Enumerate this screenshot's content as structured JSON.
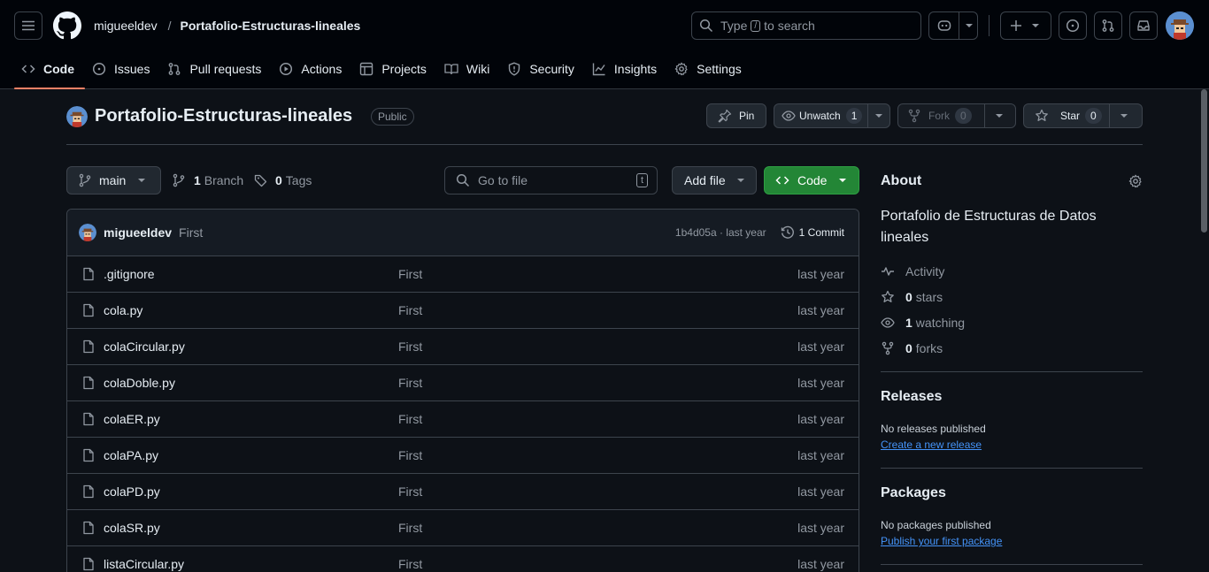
{
  "header": {
    "owner": "migueeldev",
    "separator": "/",
    "repo": "Portafolio-Estructuras-lineales",
    "search_prefix": "Type",
    "search_key": "/",
    "search_suffix": "to search"
  },
  "tabs": [
    {
      "label": "Code",
      "icon": "code-icon"
    },
    {
      "label": "Issues",
      "icon": "issue-icon"
    },
    {
      "label": "Pull requests",
      "icon": "pull-request-icon"
    },
    {
      "label": "Actions",
      "icon": "play-icon"
    },
    {
      "label": "Projects",
      "icon": "table-icon"
    },
    {
      "label": "Wiki",
      "icon": "book-icon"
    },
    {
      "label": "Security",
      "icon": "shield-icon"
    },
    {
      "label": "Insights",
      "icon": "graph-icon"
    },
    {
      "label": "Settings",
      "icon": "gear-icon"
    }
  ],
  "repo": {
    "title": "Portafolio-Estructuras-lineales",
    "visibility": "Public",
    "pin": "Pin",
    "unwatch": "Unwatch",
    "watch_count": "1",
    "fork": "Fork",
    "fork_count": "0",
    "star": "Star",
    "star_count": "0"
  },
  "toolbar": {
    "branch": "main",
    "branch_count": "1",
    "branch_label": "Branch",
    "tag_count": "0",
    "tag_label": "Tags",
    "goto_placeholder": "Go to file",
    "goto_key": "t",
    "add_file": "Add file",
    "code": "Code"
  },
  "commit": {
    "author": "migueeldev",
    "message": "First",
    "hash_time": "1b4d05a · last year",
    "commits": "1 Commit"
  },
  "files": [
    {
      "name": ".gitignore",
      "message": "First",
      "date": "last year"
    },
    {
      "name": "cola.py",
      "message": "First",
      "date": "last year"
    },
    {
      "name": "colaCircular.py",
      "message": "First",
      "date": "last year"
    },
    {
      "name": "colaDoble.py",
      "message": "First",
      "date": "last year"
    },
    {
      "name": "colaER.py",
      "message": "First",
      "date": "last year"
    },
    {
      "name": "colaPA.py",
      "message": "First",
      "date": "last year"
    },
    {
      "name": "colaPD.py",
      "message": "First",
      "date": "last year"
    },
    {
      "name": "colaSR.py",
      "message": "First",
      "date": "last year"
    },
    {
      "name": "listaCircular.py",
      "message": "First",
      "date": "last year"
    }
  ],
  "about": {
    "title": "About",
    "description": "Portafolio de Estructuras de Datos lineales",
    "activity": "Activity",
    "stars_count": "0",
    "stars_label": "stars",
    "watching_count": "1",
    "watching_label": "watching",
    "forks_count": "0",
    "forks_label": "forks"
  },
  "releases": {
    "title": "Releases",
    "empty": "No releases published",
    "link": "Create a new release"
  },
  "packages": {
    "title": "Packages",
    "empty": "No packages published",
    "link": "Publish your first package"
  },
  "colors": {
    "accent_tab": "#f78166",
    "code_button": "#238636",
    "link": "#4493f8"
  }
}
